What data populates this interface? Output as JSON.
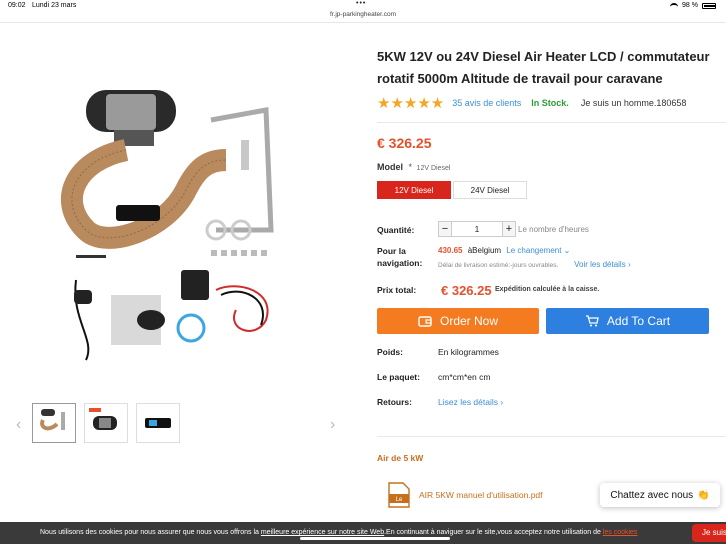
{
  "status": {
    "time": "09:02",
    "date": "Lundi 23 mars",
    "battery": "98 %"
  },
  "browser": {
    "url": "fr.jp-parkingheater.com"
  },
  "product": {
    "title": "5KW 12V ou 24V Diesel Air Heater LCD / commutateur rotatif 5000m Altitude de travail pour caravane",
    "stars": "★★★★★",
    "reviews": "35 avis de clients",
    "stock": "In Stock.",
    "man": "Je suis un homme.180658",
    "price": "€ 326.25"
  },
  "model": {
    "label": "Model",
    "required": "*",
    "selected": "12V Diesel",
    "options": [
      "12V Diesel",
      "24V Diesel"
    ]
  },
  "quantity": {
    "label": "Quantité:",
    "minus": "−",
    "value": "1",
    "plus": "+",
    "hint": "Le nombre d'heures"
  },
  "shipping": {
    "label": "Pour la navigation:",
    "amount": "430.65",
    "destination": "àBelgium",
    "change": "Le changement",
    "estimate": "Délai de livraison estimé:-jours ouvrables.",
    "details": "Voir les détails"
  },
  "total": {
    "label": "Prix total:",
    "value": "€ 326.25",
    "note": "Expédition calculée à la caisse."
  },
  "buttons": {
    "order": "Order Now",
    "cart": "Add To Cart"
  },
  "specs": {
    "weight_label": "Poids:",
    "weight_value": "En kilogrammes",
    "package_label": "Le paquet:",
    "package_value": "cm*cm*en cm",
    "returns_label": "Retours:",
    "returns_value": "Lisez les détails"
  },
  "docs": {
    "heading": "Air de 5 kW",
    "pdf_icon_text": "Le",
    "pdf": "AIR 5KW manuel d'utilisation.pdf"
  },
  "chat": {
    "label": "Chattez avec nous",
    "emoji": "👏"
  },
  "cookie": {
    "text_before": "Nous utilisons des cookies pour nous assurer que nous vous offrons la ",
    "underlined": "meilleure expérience sur notre site Web",
    "text_after": ".En continuant à naviguer sur le site,vous acceptez notre utilisation de ",
    "link": "les cookies",
    "accept": "Je suis"
  },
  "colors": {
    "accent": "#e8502a",
    "order": "#f47b20",
    "cart": "#2d7fe0",
    "selected": "#d8261d",
    "stars": "#f5a623"
  }
}
